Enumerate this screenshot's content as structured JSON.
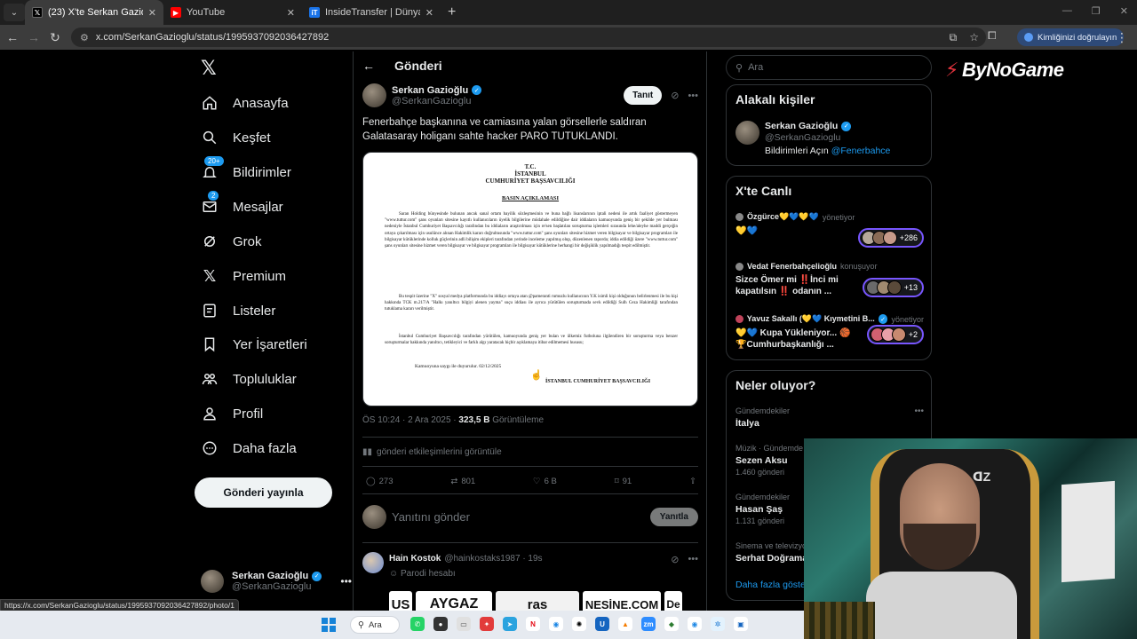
{
  "browser": {
    "tabs": [
      {
        "title": "(23) X'te Serkan Gazioğlu: \"Fen",
        "icon": "x-logo",
        "color": "#000000",
        "active": true
      },
      {
        "title": "YouTube",
        "icon": "youtube-logo",
        "color": "#ff0000",
        "active": false
      },
      {
        "title": "InsideTransfer | Dünyadan Son",
        "icon": "insidetransfer-logo",
        "color": "#1a73e8",
        "active": false
      }
    ],
    "url": "x.com/SerkanGazioglu/status/1995937092036427892",
    "profile_button": "Kimliğinizi doğrulayın",
    "status_link": "https://x.com/SerkanGazioglu/status/1995937092036427892/photo/1"
  },
  "nav": {
    "items": [
      {
        "label": "Anasayfa",
        "icon": "home-icon"
      },
      {
        "label": "Keşfet",
        "icon": "search-icon"
      },
      {
        "label": "Bildirimler",
        "icon": "bell-icon",
        "badge": "20+"
      },
      {
        "label": "Mesajlar",
        "icon": "mail-icon",
        "badge": "2"
      },
      {
        "label": "Grok",
        "icon": "grok-icon"
      },
      {
        "label": "Premium",
        "icon": "x-premium-icon"
      },
      {
        "label": "Listeler",
        "icon": "list-icon"
      },
      {
        "label": "Yer İşaretleri",
        "icon": "bookmark-icon"
      },
      {
        "label": "Topluluklar",
        "icon": "communities-icon"
      },
      {
        "label": "Profil",
        "icon": "person-icon"
      },
      {
        "label": "Daha fazla",
        "icon": "more-circle-icon"
      }
    ],
    "post_button": "Gönderi yayınla",
    "account": {
      "name": "Serkan Gazioğlu",
      "handle": "@SerkanGazioglu"
    }
  },
  "post": {
    "header": "Gönderi",
    "author": {
      "name": "Serkan Gazioğlu",
      "handle": "@SerkanGazioglu",
      "follow_label": "Tanıt"
    },
    "text": "Fenerbahçe başkanına ve camiasına yalan görsellerle saldıran Galatasaray holiganı sahte hacker PARO TUTUKLANDI.",
    "document": {
      "heading1": "T.C.",
      "heading2": "İSTANBUL",
      "heading3": "CUMHURİYET BAŞSAVCILIĞI",
      "subheading": "BASIN AÇIKLAMASI",
      "para1": "Saran Holding bünyesinde bulunan ancak sanal ortam bayilik sözleşmesinin ve buna bağlı lisanslarının iptali nedeni ile artık faaliyet göstermeyen \"www.tuttur.com\" şans oyunları sitesine kayıtlı kullanıcıların üyelik bilgilerine müdahale edildiğine dair iddiaların kamuoyunda geniş bir şekilde yer bulması nedeniyle İstanbul Cumhuriyet Başsavcılığı tarafından bu iddiaların araştırılması için re'sen başlatılan soruşturma işlemleri sırasında lehe/aleyhe maddi gerçeğin ortaya çıkarılması için usulünce alınan Hakimlik kararı doğrultusunda \"www.tuttur.com\" şans oyunları sitesine hizmet veren bilgisayar ve bilgisayar programları ile bilgisayar kütüklerinde kolluk güçlerinin adli bilişim ekipleri tarafından yerinde inceleme yapılmış olup, düzenlenen raporda; iddia edildiği üzere \"www.tuttur.com\" şans oyunları sitesine hizmet veren bilgisayar ve bilgisayar programları ile bilgisayar kütüklerine herhangi bir değişiklik yapılmadığı tespit edilmiştir.",
      "para2": "Bu tespit üzerine \"X\" sosyal medya platformunda bu iddiayı ortaya atan @pameranti rumuzlu kullanıcının Y.K isimli kişi olduğunun belirlenmesi ile bu kişi hakkında TCK m.217/A \"Halkı yanıltıcı bilgiyi alenen yayma\" suçu iddiası ile ayrıca yürütülen soruşturmada sevk edildiği Sulh Ceza Hakimliği tarafından tutuklama kararı verilmiştir.",
      "para3": "İstanbul Cumhuriyet Başsavcılığı tarafından yürütülen, kamuoyunda geniş yer bulan ve ülkemiz futboluna ilgilendiren bir soruşturma veya benzer soruşturmalar hakkında yanıltıcı, tetikleyici ve farklı algı yaratacak hiçbir açıklamaya itibar edilmemesi hususu;",
      "date_line": "Kamuoyuna saygı ile duyurulur. 02/12/2025",
      "signature": "İSTANBUL CUMHURİYET BAŞSAVCILIĞI"
    },
    "time": "ÖS 10:24 · 2 Ara 2025 · ",
    "views": "323,5 B",
    "views_label": "Görüntüleme",
    "engagements": "gönderi etkileşimlerini görüntüle",
    "stats": {
      "replies": "273",
      "reposts": "801",
      "likes": "6 B",
      "bookmarks": "91"
    },
    "reply_placeholder": "Yanıtını gönder",
    "reply_button": "Yanıtla"
  },
  "reply": {
    "name": "Hain Kostok",
    "handle": "@hainkostaks1987 · 19s",
    "label": "Parodi hesabı",
    "banner": [
      "US",
      "AYGAZ",
      "ras",
      "NESİNE.COM",
      "De"
    ]
  },
  "sidebar": {
    "search_placeholder": "Ara",
    "related": {
      "title": "Alakalı kişiler",
      "name": "Serkan Gazioğlu",
      "handle": "@SerkanGazioglu",
      "bio_prefix": "Bildirimleri Açın ",
      "bio_link": "@Fenerbahce"
    },
    "live": {
      "title": "X'te Canlı",
      "items": [
        {
          "host": "Özgürce💛💙💛💙",
          "role": "yönetiyor",
          "text": "💛💙",
          "count": "+286"
        },
        {
          "host": "Vedat Fenerbahçelioğlu",
          "role": "konuşuyor",
          "text": "Sizce Ömer mi ‼️İnci mi kapatılsın ‼️ odanın ...",
          "count": "+13"
        },
        {
          "host": "Yavuz Sakallı (💛💙 Kıymetini B...",
          "role": "yönetiyor",
          "text": "💛💙 Kupa Yükleniyor... 🏀 🏆Cumhurbaşkanlığı ...",
          "count": "+2"
        }
      ]
    },
    "trends": {
      "title": "Neler oluyor?",
      "items": [
        {
          "category": "Gündemdekiler",
          "name": "İtalya",
          "count": ""
        },
        {
          "category": "Müzik · Gündemde",
          "name": "Sezen Aksu",
          "count": "1.460 gönderi"
        },
        {
          "category": "Gündemdekiler",
          "name": "Hasan Şaş",
          "count": "1.131 gönderi"
        },
        {
          "category": "Sinema ve televizyon",
          "name": "Serhat Doğrama",
          "count": ""
        }
      ],
      "more": "Daha fazla göster"
    }
  },
  "overlay": {
    "brand": "ByNoGame",
    "brand_color": "#e0323c"
  },
  "taskbar": {
    "search": "Ara"
  }
}
